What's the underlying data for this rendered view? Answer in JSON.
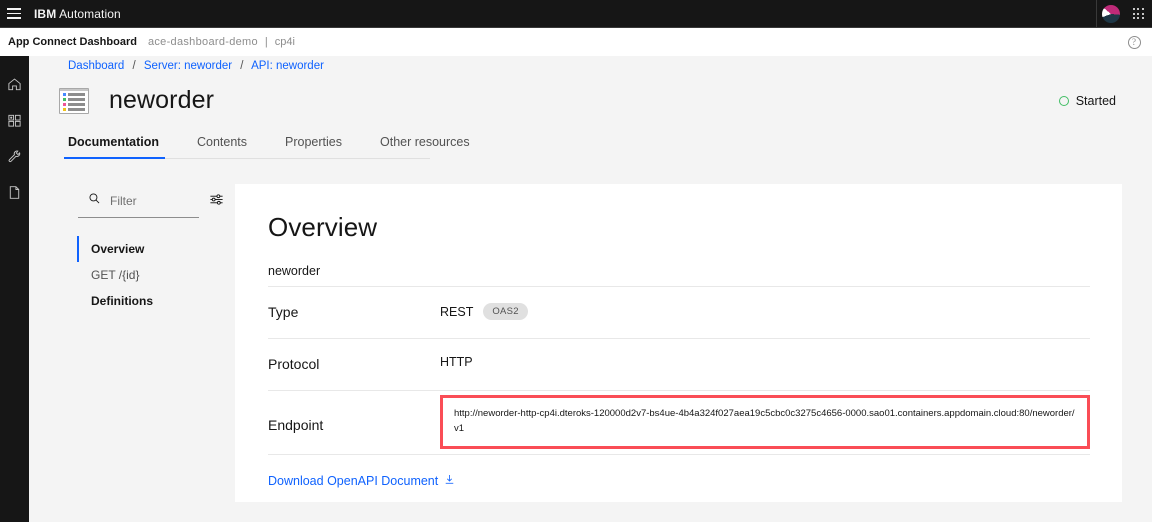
{
  "top_header": {
    "menu_icon": "hamburger-menu-icon",
    "brand_prefix": "IBM",
    "brand_name": "Automation",
    "avatar_icon": "user-avatar-icon",
    "app_switcher_icon": "app-grid-icon"
  },
  "sub_header": {
    "app_name": "App Connect Dashboard",
    "namespace": "ace-dashboard-demo",
    "separator": "|",
    "context": "cp4i",
    "help_icon": "help-circle-icon",
    "help_glyph": "?"
  },
  "rail": {
    "items": [
      {
        "icon": "home-icon",
        "name": "home"
      },
      {
        "icon": "dashboard-grid-icon",
        "name": "dashboard"
      },
      {
        "icon": "wrench-tools-icon",
        "name": "tools"
      },
      {
        "icon": "document-icon",
        "name": "documents"
      }
    ]
  },
  "breadcrumb": {
    "items": [
      {
        "label": "Dashboard"
      },
      {
        "label": "Server: neworder"
      },
      {
        "label": "API: neworder"
      }
    ],
    "separator": "/"
  },
  "page": {
    "title": "neworder",
    "icon": "api-list-window-icon",
    "status_label": "Started",
    "status_color": "#42be65"
  },
  "tabs": [
    {
      "label": "Documentation",
      "active": true
    },
    {
      "label": "Contents",
      "active": false
    },
    {
      "label": "Properties",
      "active": false
    },
    {
      "label": "Other resources",
      "active": false
    }
  ],
  "nav_panel": {
    "filter": {
      "value": "",
      "placeholder": "Filter",
      "search_icon": "search-icon",
      "settings_icon": "filter-settings-icon"
    },
    "items": [
      {
        "label": "Overview",
        "state": "active"
      },
      {
        "label": "GET /{id}",
        "state": "normal"
      },
      {
        "label": "Definitions",
        "state": "bold"
      }
    ]
  },
  "content": {
    "heading": "Overview",
    "api_name": "neworder",
    "rows": [
      {
        "label": "Type",
        "value": "REST",
        "tag": "OAS2"
      },
      {
        "label": "Protocol",
        "value": "HTTP",
        "tag": ""
      }
    ],
    "endpoint": {
      "label": "Endpoint",
      "url": "http://neworder-http-cp4i.dteroks-120000d2v7-bs4ue-4b4a324f027aea19c5cbc0c3275c4656-0000.sao01.containers.appdomain.cloud:80/neworder/v1",
      "highlight_color": "#fa4d56"
    },
    "download": {
      "label": "Download OpenAPI Document",
      "icon": "download-icon"
    }
  },
  "colors": {
    "accent_blue": "#0f62fe",
    "header_black": "#161616",
    "page_bg": "#f4f4f4",
    "status_green": "#42be65",
    "highlight_red": "#fa4d56"
  }
}
